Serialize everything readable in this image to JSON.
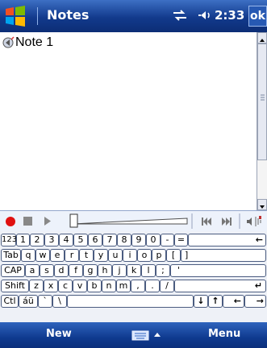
{
  "title_bar": {
    "app_title": "Notes",
    "time": "2:33",
    "ok_label": "ok",
    "icons": [
      "start-logo",
      "connectivity",
      "volume"
    ]
  },
  "document": {
    "text": "Note 1",
    "icon": "voice-note"
  },
  "record_toolbar": {
    "icons": [
      "record",
      "stop",
      "play",
      "volume-slider",
      "previous",
      "next",
      "speaker"
    ]
  },
  "keyboard": {
    "rows": [
      [
        "123",
        "1",
        "2",
        "3",
        "4",
        "5",
        "6",
        "7",
        "8",
        "9",
        "0",
        "-",
        "=",
        "←"
      ],
      [
        "Tab",
        "q",
        "w",
        "e",
        "r",
        "t",
        "y",
        "u",
        "i",
        "o",
        "p",
        "[",
        "]"
      ],
      [
        "CAP",
        "a",
        "s",
        "d",
        "f",
        "g",
        "h",
        "j",
        "k",
        "l",
        ";",
        "'"
      ],
      [
        "Shift",
        "z",
        "x",
        "c",
        "v",
        "b",
        "n",
        "m",
        ",",
        ".",
        "/",
        "↵"
      ],
      [
        "Ctl",
        "áü",
        "`",
        "\\",
        "",
        "↓",
        "↑",
        "←",
        "→"
      ]
    ]
  },
  "bottom_bar": {
    "left_label": "New",
    "right_label": "Menu",
    "input_icon": "keyboard"
  }
}
